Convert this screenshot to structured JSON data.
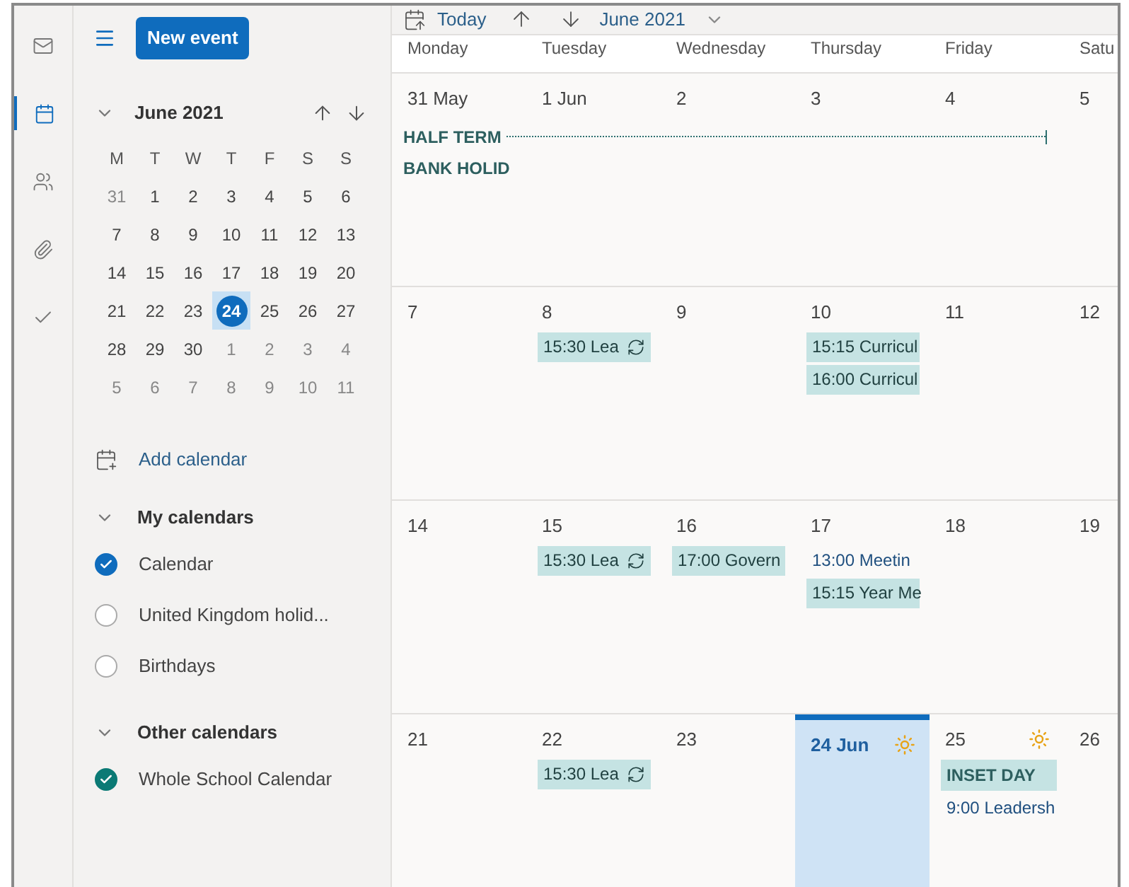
{
  "rail": [
    {
      "kind": "mail",
      "selected": false
    },
    {
      "kind": "calendar",
      "selected": true
    },
    {
      "kind": "people",
      "selected": false
    },
    {
      "kind": "attach",
      "selected": false
    },
    {
      "kind": "todo",
      "selected": false
    }
  ],
  "sidebar": {
    "new_event": "New event",
    "mini_calendar": {
      "title": "June 2021",
      "weekdays": [
        "M",
        "T",
        "W",
        "T",
        "F",
        "S",
        "S"
      ],
      "weeks": [
        [
          {
            "label": "31",
            "other_month": true,
            "selected": false
          },
          {
            "label": "1",
            "other_month": false,
            "selected": false
          },
          {
            "label": "2",
            "other_month": false,
            "selected": false
          },
          {
            "label": "3",
            "other_month": false,
            "selected": false
          },
          {
            "label": "4",
            "other_month": false,
            "selected": false
          },
          {
            "label": "5",
            "other_month": false,
            "selected": false
          },
          {
            "label": "6",
            "other_month": false,
            "selected": false
          }
        ],
        [
          {
            "label": "7",
            "other_month": false,
            "selected": false
          },
          {
            "label": "8",
            "other_month": false,
            "selected": false
          },
          {
            "label": "9",
            "other_month": false,
            "selected": false
          },
          {
            "label": "10",
            "other_month": false,
            "selected": false
          },
          {
            "label": "11",
            "other_month": false,
            "selected": false
          },
          {
            "label": "12",
            "other_month": false,
            "selected": false
          },
          {
            "label": "13",
            "other_month": false,
            "selected": false
          }
        ],
        [
          {
            "label": "14",
            "other_month": false,
            "selected": false
          },
          {
            "label": "15",
            "other_month": false,
            "selected": false
          },
          {
            "label": "16",
            "other_month": false,
            "selected": false
          },
          {
            "label": "17",
            "other_month": false,
            "selected": false
          },
          {
            "label": "18",
            "other_month": false,
            "selected": false
          },
          {
            "label": "19",
            "other_month": false,
            "selected": false
          },
          {
            "label": "20",
            "other_month": false,
            "selected": false
          }
        ],
        [
          {
            "label": "21",
            "other_month": false,
            "selected": false
          },
          {
            "label": "22",
            "other_month": false,
            "selected": false
          },
          {
            "label": "23",
            "other_month": false,
            "selected": false
          },
          {
            "label": "24",
            "other_month": false,
            "selected": true
          },
          {
            "label": "25",
            "other_month": false,
            "selected": false
          },
          {
            "label": "26",
            "other_month": false,
            "selected": false
          },
          {
            "label": "27",
            "other_month": false,
            "selected": false
          }
        ],
        [
          {
            "label": "28",
            "other_month": false,
            "selected": false
          },
          {
            "label": "29",
            "other_month": false,
            "selected": false
          },
          {
            "label": "30",
            "other_month": false,
            "selected": false
          },
          {
            "label": "1",
            "other_month": true,
            "selected": false
          },
          {
            "label": "2",
            "other_month": true,
            "selected": false
          },
          {
            "label": "3",
            "other_month": true,
            "selected": false
          },
          {
            "label": "4",
            "other_month": true,
            "selected": false
          }
        ],
        [
          {
            "label": "5",
            "other_month": true,
            "selected": false
          },
          {
            "label": "6",
            "other_month": true,
            "selected": false
          },
          {
            "label": "7",
            "other_month": true,
            "selected": false
          },
          {
            "label": "8",
            "other_month": true,
            "selected": false
          },
          {
            "label": "9",
            "other_month": true,
            "selected": false
          },
          {
            "label": "10",
            "other_month": true,
            "selected": false
          },
          {
            "label": "11",
            "other_month": true,
            "selected": false
          }
        ]
      ]
    },
    "add_calendar": "Add calendar",
    "groups": [
      {
        "title": "My calendars",
        "expanded": true,
        "items": [
          {
            "label": "Calendar",
            "checked": true,
            "color": "#0f6cbd"
          },
          {
            "label": "United Kingdom holid...",
            "checked": false
          },
          {
            "label": "Birthdays",
            "checked": false
          }
        ]
      },
      {
        "title": "Other calendars",
        "expanded": true,
        "items": [
          {
            "label": "Whole School Calendar",
            "checked": true,
            "color": "#0b7a75"
          }
        ]
      }
    ]
  },
  "toolbar": {
    "today": "Today",
    "month": "June 2021"
  },
  "calendar": {
    "weekdays": [
      "Monday",
      "Tuesday",
      "Wednesday",
      "Thursday",
      "Friday",
      "Satu"
    ],
    "weeks": [
      {
        "spans": [
          {
            "text": "HALF TERM"
          }
        ],
        "days": [
          {
            "label": "31 May",
            "today": false,
            "weather": false,
            "events": [
              {
                "kind": "allday",
                "text": "BANK HOLID"
              }
            ]
          },
          {
            "label": "1 Jun",
            "today": false,
            "weather": false
          },
          {
            "label": "2",
            "today": false,
            "weather": false
          },
          {
            "label": "3",
            "today": false,
            "weather": false
          },
          {
            "label": "4",
            "today": false,
            "weather": false
          },
          {
            "label": "5",
            "today": false
          }
        ]
      },
      {
        "days": [
          {
            "label": "7",
            "today": false,
            "weather": false
          },
          {
            "label": "8",
            "today": false,
            "weather": false,
            "events": [
              {
                "kind": "block",
                "text": "15:30 Lea",
                "recurring": true
              }
            ]
          },
          {
            "label": "9",
            "today": false,
            "weather": false
          },
          {
            "label": "10",
            "today": false,
            "weather": false,
            "events": [
              {
                "kind": "block",
                "text": "15:15 Curricul",
                "recurring": false
              },
              {
                "kind": "block",
                "text": "16:00 Curricul",
                "recurring": false
              }
            ]
          },
          {
            "label": "11",
            "today": false,
            "weather": false
          },
          {
            "label": "12",
            "today": false
          }
        ]
      },
      {
        "days": [
          {
            "label": "14",
            "today": false,
            "weather": false
          },
          {
            "label": "15",
            "today": false,
            "weather": false,
            "events": [
              {
                "kind": "block",
                "text": "15:30 Lea",
                "recurring": true
              }
            ]
          },
          {
            "label": "16",
            "today": false,
            "weather": false,
            "events": [
              {
                "kind": "block",
                "text": "17:00 Govern",
                "recurring": false
              }
            ]
          },
          {
            "label": "17",
            "today": false,
            "weather": false,
            "events": [
              {
                "kind": "text",
                "text": "13:00 Meetin"
              },
              {
                "kind": "block",
                "text": "15:15 Year Me",
                "recurring": false
              }
            ]
          },
          {
            "label": "18",
            "today": false,
            "weather": false
          },
          {
            "label": "19",
            "today": false
          }
        ]
      },
      {
        "days": [
          {
            "label": "21",
            "today": false,
            "weather": false
          },
          {
            "label": "22",
            "today": false,
            "weather": false,
            "events": [
              {
                "kind": "block",
                "text": "15:30 Lea",
                "recurring": true
              }
            ]
          },
          {
            "label": "23",
            "today": false,
            "weather": false
          },
          {
            "label": "24 Jun",
            "today": true,
            "weather": true
          },
          {
            "label": "25",
            "today": false,
            "weather": true,
            "events": [
              {
                "kind": "allday",
                "text": "INSET DAY"
              },
              {
                "kind": "text",
                "text": "9:00 Leadersh"
              }
            ]
          },
          {
            "label": "26",
            "today": false
          }
        ]
      }
    ]
  }
}
